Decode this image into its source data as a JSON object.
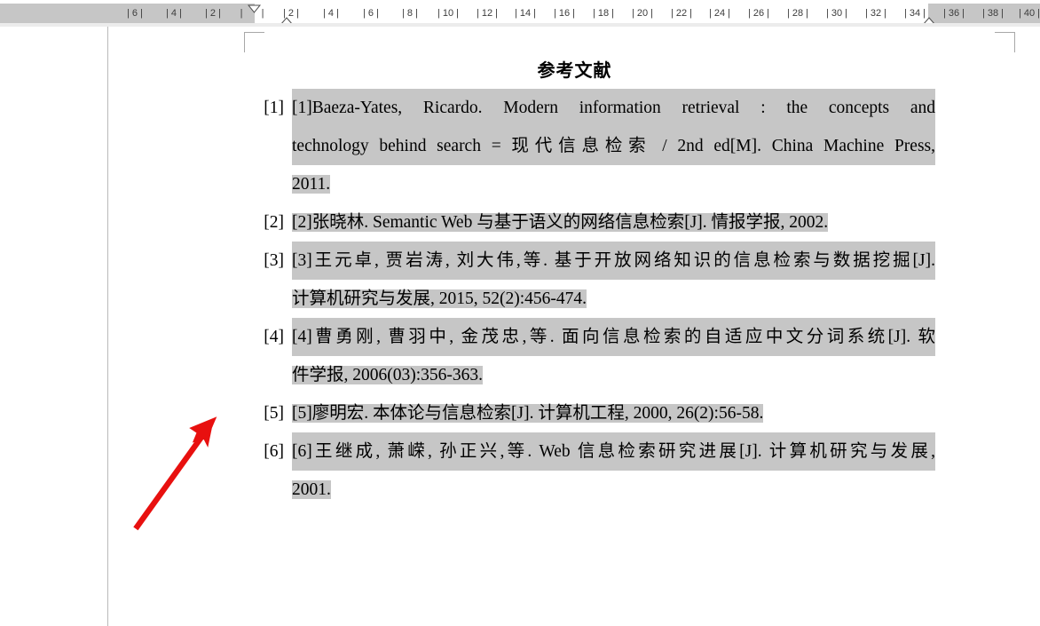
{
  "ruler": {
    "unit_labels": [
      "6",
      "4",
      "2",
      "2",
      "4",
      "6",
      "8",
      "10",
      "12",
      "14",
      "16",
      "18",
      "20",
      "22",
      "24",
      "26",
      "28",
      "30",
      "32",
      "34",
      "36",
      "38",
      "40"
    ],
    "tick_glyph": "|",
    "left_margin_label": "left-margin-zone",
    "right_margin_label": "right-margin-zone",
    "first_line_indent_marker": "first-line-indent",
    "hanging_indent_marker": "hanging-indent",
    "left_indent_marker": "left-indent-box",
    "right_indent_marker": "right-indent"
  },
  "document": {
    "title": "参考文献",
    "references": [
      {
        "number": "[1]",
        "text": "[1]Baeza-Yates, Ricardo. Modern information retrieval : the concepts and technology behind search = 现代信息检索 / 2nd ed[M]. China Machine Press, 2011.",
        "lines": [
          "[1]Baeza-Yates, Ricardo. Modern information retrieval : the concepts and",
          "technology behind search = 现代信息检索 / 2nd ed[M]. China Machine Press,",
          "2011."
        ],
        "highlighted": true
      },
      {
        "number": "[2]",
        "text": "[2]张晓林. Semantic Web 与基于语义的网络信息检索[J]. 情报学报, 2002.",
        "lines": [
          "[2]张晓林. Semantic Web 与基于语义的网络信息检索[J]. 情报学报, 2002."
        ],
        "highlighted": true
      },
      {
        "number": "[3]",
        "text": "[3]王元卓, 贾岩涛, 刘大伟,等. 基于开放网络知识的信息检索与数据挖掘[J]. 计算机研究与发展, 2015, 52(2):456-474.",
        "lines": [
          "[3]王元卓, 贾岩涛, 刘大伟,等. 基于开放网络知识的信息检索与数据挖掘[J].",
          "计算机研究与发展, 2015, 52(2):456-474."
        ],
        "highlighted": true
      },
      {
        "number": "[4]",
        "text": "[4]曹勇刚, 曹羽中, 金茂忠,等. 面向信息检索的自适应中文分词系统[J]. 软件学报, 2006(03):356-363.",
        "lines": [
          "[4]曹勇刚, 曹羽中, 金茂忠,等. 面向信息检索的自适应中文分词系统[J]. 软",
          "件学报, 2006(03):356-363."
        ],
        "highlighted": true
      },
      {
        "number": "[5]",
        "text": "[5]廖明宏. 本体论与信息检索[J]. 计算机工程, 2000, 26(2):56-58.",
        "lines": [
          "[5]廖明宏. 本体论与信息检索[J]. 计算机工程, 2000, 26(2):56-58."
        ],
        "highlighted": true
      },
      {
        "number": "[6]",
        "text": "[6]王继成, 萧嵘, 孙正兴,等. Web 信息检索研究进展[J]. 计算机研究与发展, 2001.",
        "lines": [
          "[6]王继成, 萧嵘, 孙正兴,等. Web 信息检索研究进展[J]. 计算机研究与发展,",
          "2001."
        ],
        "highlighted": true
      }
    ]
  },
  "annotation": {
    "arrow_color": "#e8100f",
    "arrow_name": "red-pointer-arrow",
    "points_to": "[5]"
  },
  "colors": {
    "selection_highlight": "#c6c6c6",
    "ruler_margin": "#c6c6c6",
    "page_background": "#ffffff",
    "text": "#000000"
  }
}
